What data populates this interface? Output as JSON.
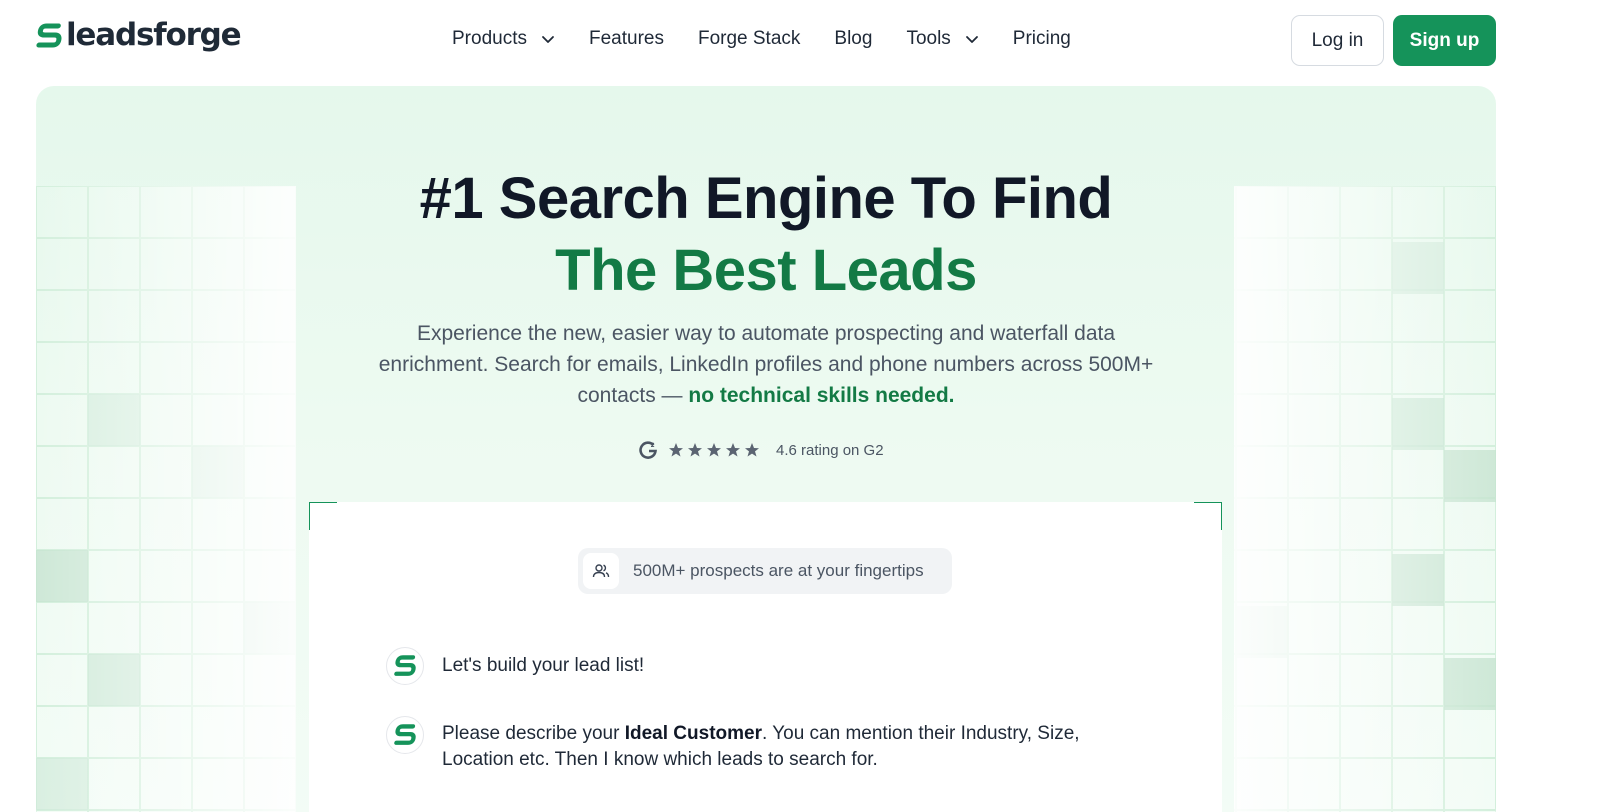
{
  "brand": {
    "name": "leadsforge",
    "accent": "#15935a",
    "accent_dark": "#137a45"
  },
  "nav": {
    "items": [
      {
        "label": "Products",
        "has_dropdown": true
      },
      {
        "label": "Features",
        "has_dropdown": false
      },
      {
        "label": "Forge Stack",
        "has_dropdown": false
      },
      {
        "label": "Blog",
        "has_dropdown": false
      },
      {
        "label": "Tools",
        "has_dropdown": true
      },
      {
        "label": "Pricing",
        "has_dropdown": false
      }
    ],
    "login_label": "Log in",
    "signup_label": "Sign up"
  },
  "hero": {
    "title_line1": "#1 Search Engine To Find",
    "title_line2": "The Best Leads",
    "subtitle": "Experience the new, easier way to automate prospecting and waterfall data enrichment. Search for emails, LinkedIn profiles and phone numbers across 500M+ contacts —",
    "subtitle_highlight": "no technical skills needed.",
    "rating": {
      "stars": 5,
      "text": "4.6 rating on G2",
      "icon": "g2-icon"
    }
  },
  "chat": {
    "pill_text": "500M+ prospects are at your fingertips",
    "pill_icon": "users-icon",
    "messages": [
      {
        "text": "Let's build your lead list!"
      },
      {
        "pre": "Please describe your ",
        "bold": "Ideal Customer",
        "post": ". You can mention their Industry, Size, Location etc. Then I know which leads to search for."
      }
    ]
  }
}
